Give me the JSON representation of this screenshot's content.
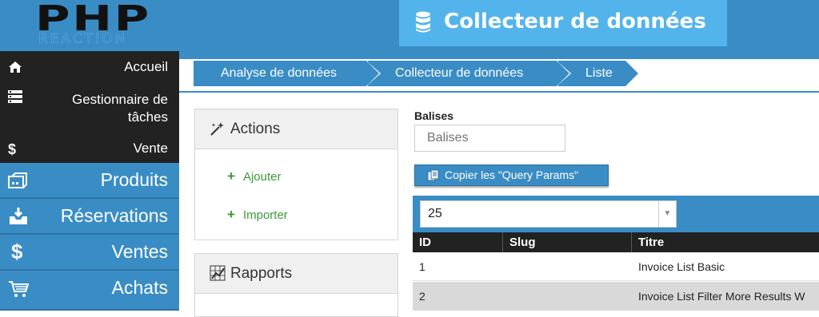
{
  "header": {
    "logo_text": "PHP",
    "logo_subtext": "REACTION",
    "page_title": "Collecteur de données"
  },
  "sidebar": {
    "items": [
      {
        "label": "Accueil",
        "icon": "home-icon"
      },
      {
        "label": "Gestionnaire de tâches",
        "icon": "tasks-icon"
      },
      {
        "label": "Vente",
        "icon": "dollar-icon"
      },
      {
        "label": "Produits",
        "icon": "products-icon"
      },
      {
        "label": "Réservations",
        "icon": "inbox-icon"
      },
      {
        "label": "Ventes",
        "icon": "dollar-icon"
      },
      {
        "label": "Achats",
        "icon": "cart-icon"
      }
    ]
  },
  "breadcrumb": [
    "Analyse de données",
    "Collecteur de données",
    "Liste"
  ],
  "actions_panel": {
    "title": "Actions",
    "links": [
      "Ajouter",
      "Importer"
    ]
  },
  "reports_panel": {
    "title": "Rapports"
  },
  "filters": {
    "tags_label": "Balises",
    "tags_placeholder": "Balises",
    "copy_button": "Copier les \"Query Params\""
  },
  "table": {
    "page_size": "25",
    "columns": [
      "ID",
      "Slug",
      "Titre"
    ],
    "rows": [
      {
        "id": "1",
        "slug": "",
        "title": "Invoice List Basic"
      },
      {
        "id": "2",
        "slug": "",
        "title": "Invoice List Filter More Results W"
      }
    ]
  },
  "colors": {
    "primary": "#3a8dc4",
    "title_bg": "#53b4ec",
    "sidebar_dark": "#222222",
    "link_green": "#3a9a3a"
  }
}
